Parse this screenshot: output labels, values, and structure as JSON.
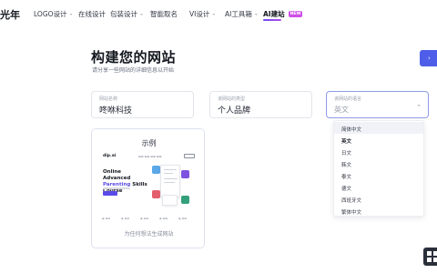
{
  "nav": {
    "logo_text": "光年",
    "items": [
      {
        "label": "LOGO设计",
        "has_chevron": true
      },
      {
        "label": "在线设计",
        "has_chevron": false
      },
      {
        "label": "包装设计",
        "has_chevron": true
      },
      {
        "label": "智能取名",
        "has_chevron": false
      },
      {
        "label": "VI设计",
        "has_chevron": true
      },
      {
        "label": "AI工具箱",
        "has_chevron": true
      },
      {
        "label": "AI建站",
        "has_chevron": false
      }
    ],
    "new_badge": "NEW",
    "accent_gradient": [
      "#6d4cf5",
      "#b04ce8"
    ]
  },
  "header": {
    "title": "构建您的网站",
    "subtitle": "请分享一些网站的详细信息以开始"
  },
  "form": {
    "site_name": {
      "label": "网站名称",
      "value": "咚咻科技"
    },
    "site_type": {
      "label": "该网站的类型",
      "value": "个人品牌"
    },
    "site_language": {
      "label": "该网站的语言",
      "value": "英文"
    }
  },
  "language_dropdown": {
    "options": [
      "简体中文",
      "英文",
      "日文",
      "韩文",
      "泰文",
      "德文",
      "西班牙文",
      "繁体中文"
    ],
    "selected": "英文",
    "hovered": "简体中文"
  },
  "example_card": {
    "title": "示例",
    "footer": "为任何想法生成网站",
    "preview": {
      "logo": "dip.ai",
      "hero_line1": "Online Advanced",
      "hero_accent": "Parenting",
      "hero_line2": "Skills",
      "hero_line3": "Course"
    }
  },
  "colors": {
    "primary_button": "#4e5ee8",
    "focus_border": "#8f9be8",
    "preview_accent": "#5a4be8"
  }
}
